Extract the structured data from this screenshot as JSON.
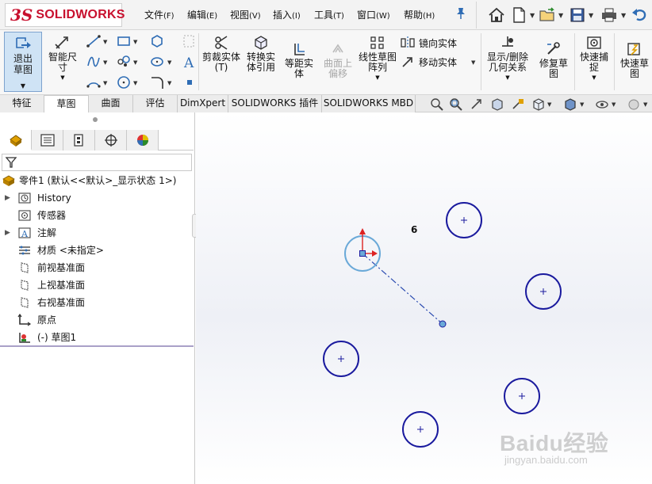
{
  "app": {
    "logo_mark": "3S",
    "logo_text": "SOLIDWORKS"
  },
  "menu": {
    "items": [
      {
        "label": "文件",
        "key": "(F)"
      },
      {
        "label": "编辑",
        "key": "(E)"
      },
      {
        "label": "视图",
        "key": "(V)"
      },
      {
        "label": "插入",
        "key": "(I)"
      },
      {
        "label": "工具",
        "key": "(T)"
      },
      {
        "label": "窗口",
        "key": "(W)"
      },
      {
        "label": "帮助",
        "key": "(H)"
      }
    ]
  },
  "ribbon": {
    "exit_sketch": "退出草图",
    "smart_dim": "智能尺寸",
    "trim": "剪裁实体",
    "trim2": "(T)",
    "convert": "转换实体引用",
    "offset": "等距实体",
    "surface_offset": "曲面上偏移",
    "linear_pattern": "线性草图阵列",
    "mirror": "镜向实体",
    "move": "移动实体",
    "show_delete_relations": "显示/删除几何关系",
    "repair": "修复草图",
    "quick_snap": "快速捕捉",
    "quick_sketch": "快速草图"
  },
  "tabs": [
    {
      "label": "特征",
      "active": false
    },
    {
      "label": "草图",
      "active": true
    },
    {
      "label": "曲面",
      "active": false
    },
    {
      "label": "评估",
      "active": false
    },
    {
      "label": "DimXpert",
      "active": false
    },
    {
      "label": "SOLIDWORKS 插件",
      "active": false
    },
    {
      "label": "SOLIDWORKS MBD",
      "active": false
    }
  ],
  "tree": {
    "root": "零件1 (默认<<默认>_显示状态 1>)",
    "items": [
      {
        "label": "History",
        "expandable": true
      },
      {
        "label": "传感器",
        "expandable": false
      },
      {
        "label": "注解",
        "expandable": true
      },
      {
        "label": "材质 <未指定>",
        "expandable": false
      },
      {
        "label": "前视基准面",
        "expandable": false
      },
      {
        "label": "上视基准面",
        "expandable": false
      },
      {
        "label": "右视基准面",
        "expandable": false
      },
      {
        "label": "原点",
        "expandable": false
      },
      {
        "label": "(-) 草图1",
        "expandable": false
      }
    ]
  },
  "canvas": {
    "dimension_value": "6"
  },
  "watermark": {
    "line1": "Baidu经验",
    "line2": "jingyan.baidu.com"
  },
  "colors": {
    "accent": "#1a1a9e",
    "selection": "#6aa9d8",
    "brand": "#c8102e"
  }
}
